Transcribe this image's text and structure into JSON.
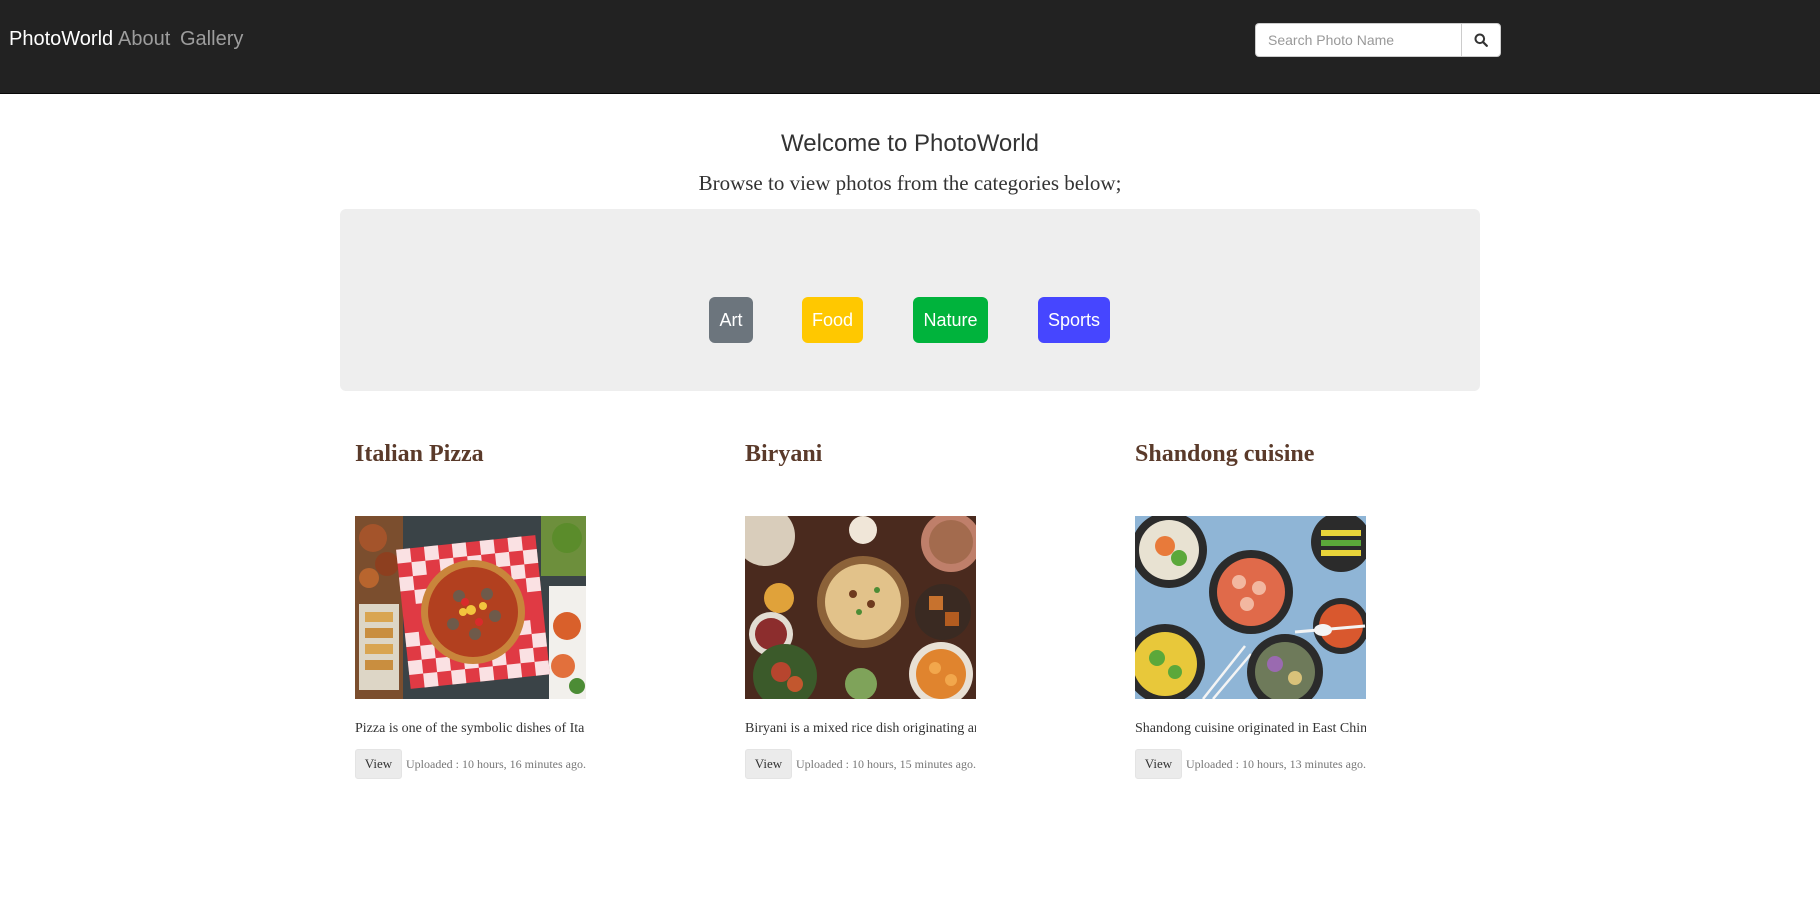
{
  "nav": {
    "brand": "PhotoWorld",
    "links": [
      "About",
      "Gallery"
    ],
    "search_placeholder": "Search Photo Name",
    "search_icon": "search-icon"
  },
  "header": {
    "title": "Welcome to PhotoWorld",
    "subtitle": "Browse to view photos from the categories below;"
  },
  "categories": [
    {
      "label": "Art",
      "color": "#6c757d"
    },
    {
      "label": "Food",
      "color": "#ffc800"
    },
    {
      "label": "Nature",
      "color": "#00b33c"
    },
    {
      "label": "Sports",
      "color": "#4646ff"
    }
  ],
  "photos": [
    {
      "title": "Italian Pizza",
      "description": "Pizza is one of the symbolic dishes of Ita",
      "view_label": "View",
      "uploaded": "Uploaded : 10 hours, 16 minutes ago.",
      "image": "pizza-photo"
    },
    {
      "title": "Biryani",
      "description": "Biryani is a mixed rice dish originating ar",
      "view_label": "View",
      "uploaded": "Uploaded : 10 hours, 15 minutes ago.",
      "image": "biryani-photo"
    },
    {
      "title": "Shandong cuisine",
      "description": "Shandong cuisine originated in East Chin",
      "view_label": "View",
      "uploaded": "Uploaded : 10 hours, 13 minutes ago.",
      "image": "shandong-cuisine-photo"
    }
  ]
}
